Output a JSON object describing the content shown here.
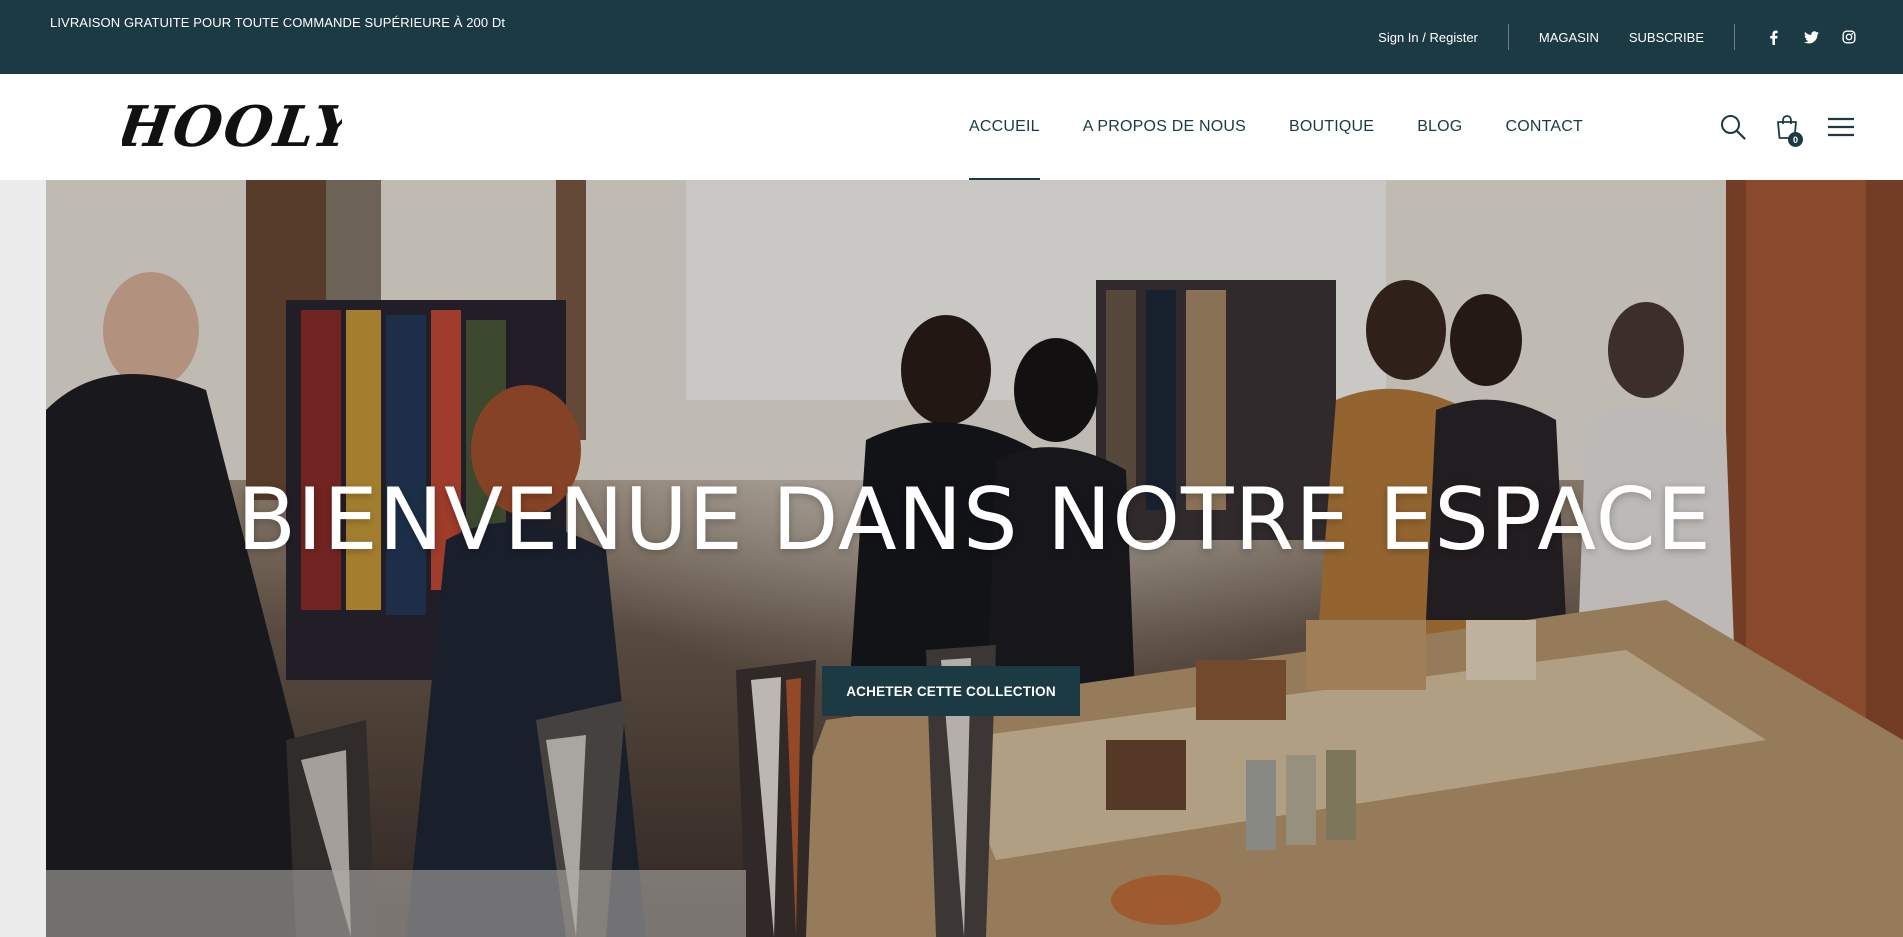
{
  "topbar": {
    "promo": "LIVRAISON GRATUITE POUR TOUTE COMMANDE SUPÉRIEURE À 200 Dt",
    "signin": "Sign In / Register",
    "store": "MAGASIN",
    "subscribe": "SUBSCRIBE",
    "social": [
      "facebook-icon",
      "twitter-icon",
      "instagram-icon"
    ]
  },
  "header": {
    "logo": "HOOLY",
    "nav": [
      {
        "label": "ACCUEIL",
        "active": true
      },
      {
        "label": "A PROPOS DE NOUS",
        "active": false
      },
      {
        "label": "BOUTIQUE",
        "active": false
      },
      {
        "label": "BLOG",
        "active": false
      },
      {
        "label": "CONTACT",
        "active": false
      }
    ],
    "icons": [
      "search-icon",
      "cart-icon",
      "menu-icon"
    ],
    "cart_count": "0"
  },
  "hero": {
    "title": "BIENVENUE DANS NOTRE ESPACE",
    "cta": "ACHETER CETTE COLLECTION"
  },
  "colors": {
    "brand": "#1b3a44",
    "topbar_bg": "#1b3a44",
    "header_bg": "#ffffff",
    "cta_bg": "#1b3a44"
  }
}
